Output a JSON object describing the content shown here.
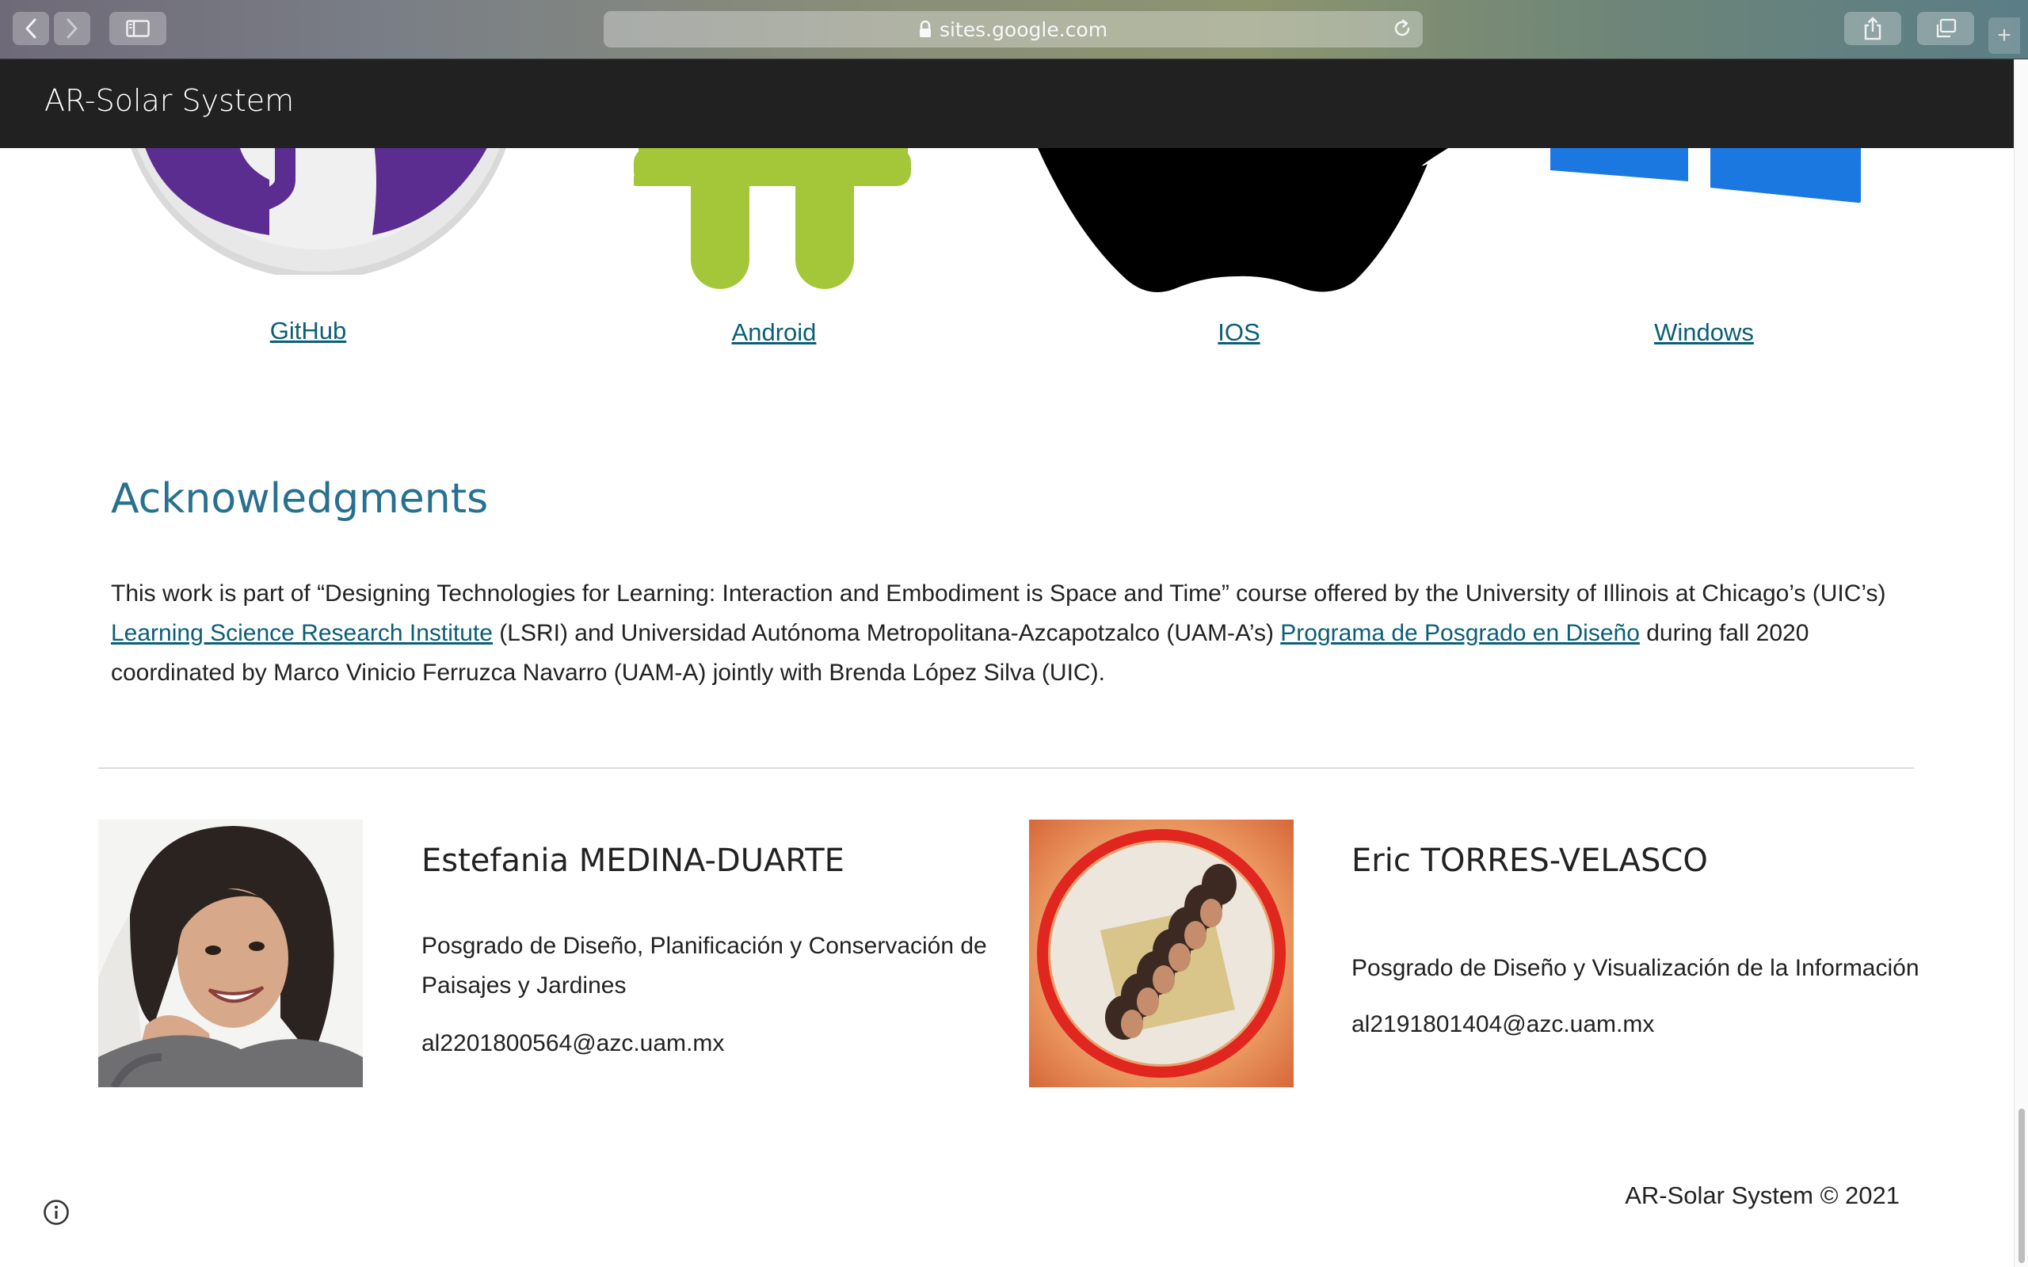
{
  "browser": {
    "url": "sites.google.com",
    "new_tab": "+"
  },
  "site": {
    "title": "AR-Solar System"
  },
  "platforms": [
    {
      "label": "GitHub",
      "icon": "github-logo"
    },
    {
      "label": "Android",
      "icon": "android-logo"
    },
    {
      "label": "IOS",
      "icon": "apple-logo"
    },
    {
      "label": "Windows",
      "icon": "windows-logo"
    }
  ],
  "acknowledgments": {
    "heading": "Acknowledgments",
    "text_1": "This work is part of “Designing Technologies for Learning: Interaction and Embodiment is Space and Time” course offered by the University of Illinois at Chicago’s (UIC’s) ",
    "link_1": "Learning Science Research Institute",
    "text_2": " (LSRI) and Universidad Autónoma Metropolitana-Azcapotzalco (UAM-A’s) ",
    "link_2": "Programa de Posgrado en Diseño",
    "text_3": " during fall 2020 coordinated by Marco Vinicio Ferruzca Navarro (UAM-A) jointly with Brenda López Silva (UIC)."
  },
  "people": [
    {
      "name": "Estefania MEDINA-DUARTE",
      "department": "Posgrado de Diseño, Planificación y Conservación de Paisajes y Jardines",
      "email": "al2201800564@azc.uam.mx"
    },
    {
      "name": "Eric TORRES-VELASCO",
      "department": "Posgrado de Diseño y Visualización de la Información",
      "email": "al2191801404@azc.uam.mx"
    }
  ],
  "footer": {
    "copyright": "AR-Solar System © 2021"
  },
  "colors": {
    "header_bg": "#212121",
    "heading": "#27718f",
    "link": "#0b5e76",
    "android_green": "#a4c639",
    "github_purple": "#5b2d90",
    "windows_blue": "#1a78e0"
  }
}
